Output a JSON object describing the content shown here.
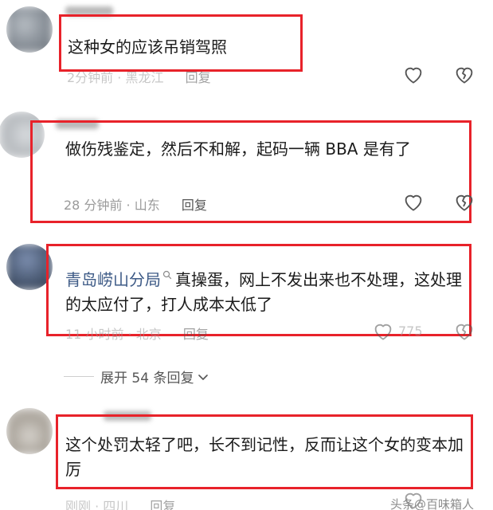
{
  "comments": [
    {
      "text": "这种女的应该吊销驾照",
      "time": "2分钟前",
      "sep": "·",
      "location": "黑龙江",
      "reply": "回复"
    },
    {
      "text": "做伤残鉴定，然后不和解，起码一辆 BBA 是有了",
      "time": "28 分钟前",
      "sep": "·",
      "location": "山东",
      "reply": "回复"
    },
    {
      "author": "青岛崂山分局",
      "text": "真操蛋，网上不发出来也不处理，这处理的太应付了，打人成本太低了",
      "time": "11 小时前",
      "sep": "·",
      "location": "北京",
      "reply": "回复",
      "likes": "775"
    },
    {
      "text": "这个处罚太轻了吧，长不到记性，反而让这个女的变本加厉",
      "time": "刚刚",
      "sep": "·",
      "location": "四川",
      "reply": "回复"
    }
  ],
  "expand_replies": "展开 54 条回复",
  "watermark": "头条@百味箱人",
  "icons": {
    "like": "heart-icon",
    "dislike": "broken-heart-icon",
    "expand": "chevron-down-icon",
    "author_badge": "search-icon"
  },
  "colors": {
    "highlight_border": "#e8222a",
    "author_link": "#3d5a86",
    "meta_text": "#9a9a9a"
  }
}
